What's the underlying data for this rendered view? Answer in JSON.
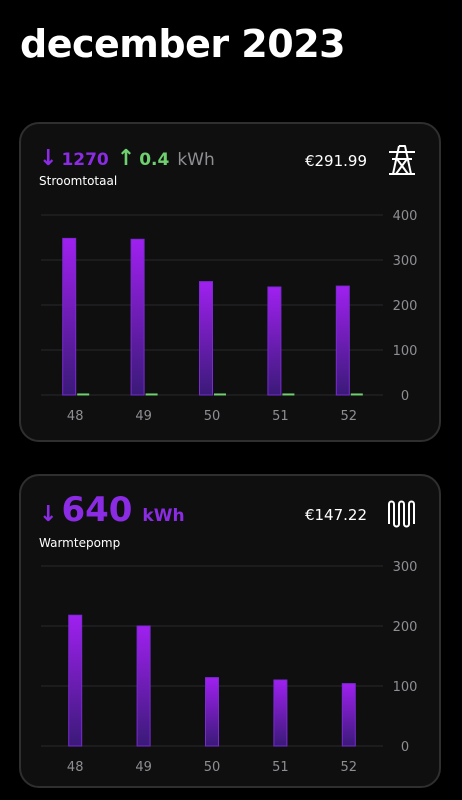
{
  "page": {
    "title": "december 2023"
  },
  "colors": {
    "consumption": "#8b2be3",
    "return": "#6fd06f",
    "background": "#000000",
    "card": "#0f0f10",
    "grid": "#2a2a2c"
  },
  "cards": [
    {
      "name": "stroomtotaal",
      "arrow_down": "↓",
      "consumption_value": "1270",
      "arrow_up": "↑",
      "return_value": "0.4",
      "unit": "kWh",
      "label": "Stroomtotaal",
      "price": "€291.99",
      "icon": "power-pylon-icon"
    },
    {
      "name": "warmtepomp",
      "arrow_down": "↓",
      "consumption_value": "640",
      "unit": "kWh",
      "label": "Warmtepomp",
      "price": "€147.22",
      "icon": "radiator-icon"
    }
  ],
  "chart_data": [
    {
      "type": "bar",
      "categories": [
        "48",
        "49",
        "50",
        "51",
        "52"
      ],
      "series": [
        {
          "values": [
            348,
            346,
            252,
            240,
            242
          ]
        },
        {
          "values": [
            0.1,
            0.1,
            0.1,
            0.1,
            0.1
          ]
        }
      ],
      "yticks": [
        "0",
        "100",
        "200",
        "300",
        "400"
      ],
      "ylim": [
        0,
        400
      ],
      "grid": true
    },
    {
      "type": "bar",
      "categories": [
        "48",
        "49",
        "50",
        "51",
        "52"
      ],
      "series": [
        {
          "values": [
            218,
            200,
            114,
            110,
            104
          ]
        }
      ],
      "yticks": [
        "0",
        "100",
        "200",
        "300"
      ],
      "ylim": [
        0,
        300
      ],
      "grid": true
    }
  ]
}
